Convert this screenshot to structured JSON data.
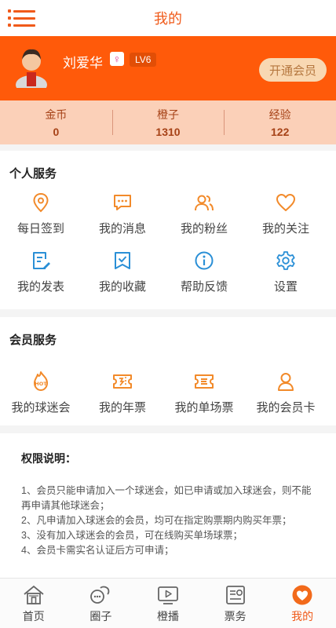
{
  "header": {
    "title": "我的",
    "menu_icon": "menu-icon"
  },
  "profile": {
    "name": "刘爱华",
    "gender_symbol": "♀",
    "level": "LV6",
    "vip_button": "开通会员"
  },
  "stats": [
    {
      "label": "金币",
      "value": "0"
    },
    {
      "label": "橙子",
      "value": "1310"
    },
    {
      "label": "经验",
      "value": "122"
    }
  ],
  "personal_services": {
    "title": "个人服务",
    "items": [
      {
        "label": "每日签到",
        "icon": "location-pin-icon"
      },
      {
        "label": "我的消息",
        "icon": "message-icon"
      },
      {
        "label": "我的粉丝",
        "icon": "fans-icon"
      },
      {
        "label": "我的关注",
        "icon": "heart-icon"
      },
      {
        "label": "我的发表",
        "icon": "edit-doc-icon"
      },
      {
        "label": "我的收藏",
        "icon": "bookmark-icon"
      },
      {
        "label": "帮助反馈",
        "icon": "info-icon"
      },
      {
        "label": "设置",
        "icon": "gear-icon"
      }
    ]
  },
  "member_services": {
    "title": "会员服务",
    "items": [
      {
        "label": "我的球迷会",
        "icon": "hot-badge-icon"
      },
      {
        "label": "我的年票",
        "icon": "annual-ticket-icon"
      },
      {
        "label": "我的单场票",
        "icon": "single-ticket-icon"
      },
      {
        "label": "我的会员卡",
        "icon": "member-card-icon"
      }
    ]
  },
  "rights": {
    "title": "权限说明：",
    "items": [
      "1、会员只能申请加入一个球迷会，如已申请或加入球迷会，则不能再申请其他球迷会；",
      "2、凡申请加入球迷会的会员，均可在指定购票期内购买年票；",
      "3、没有加入球迷会的会员，可在线购买单场球票；",
      "4、会员卡需实名认证后方可申请；"
    ]
  },
  "tabbar": [
    {
      "label": "首页",
      "icon": "home-icon"
    },
    {
      "label": "圈子",
      "icon": "circle-icon"
    },
    {
      "label": "橙播",
      "icon": "video-play-icon"
    },
    {
      "label": "票务",
      "icon": "ticket-icon"
    },
    {
      "label": "我的",
      "icon": "me-icon",
      "active": true
    }
  ],
  "colors": {
    "accent": "#f05a1a",
    "profile_bg": "#ff5a0a",
    "stats_bg": "#fbd0b8",
    "icon_orange": "#f28a2a",
    "icon_blue": "#2a8fd6"
  }
}
